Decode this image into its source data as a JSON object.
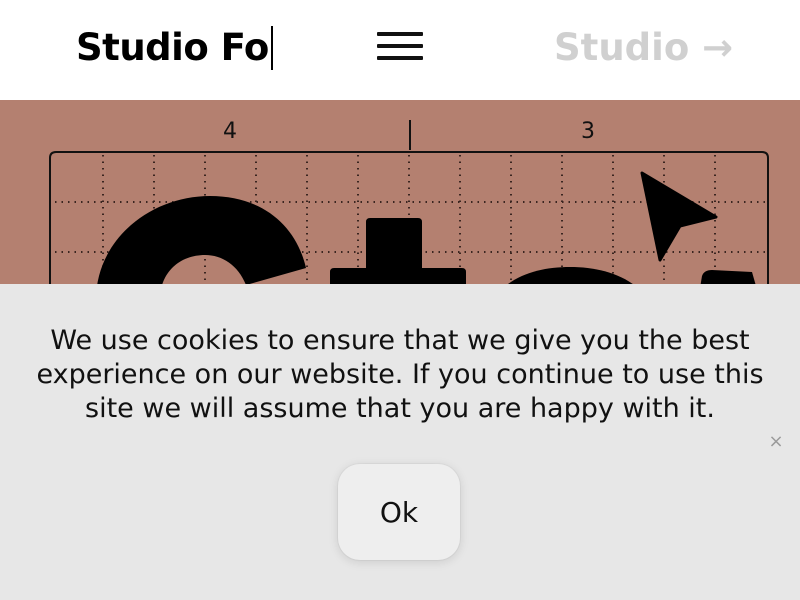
{
  "header": {
    "brand": "Studio Fo",
    "next_link": "Studio →"
  },
  "hero": {
    "ruler_labels": [
      "4",
      "3"
    ]
  },
  "cookie": {
    "message": "We use cookies to ensure that we give you the best experience on our website. If you continue to use this site we will assume that you are happy with it.",
    "ok_label": "Ok",
    "close_label": "×"
  },
  "colors": {
    "hero_bg": "#b48070",
    "banner_bg": "#e7e7e7",
    "muted_link": "#d0d0d0"
  },
  "icons": [
    "menu-icon",
    "cursor-arrow-icon",
    "close-icon"
  ]
}
